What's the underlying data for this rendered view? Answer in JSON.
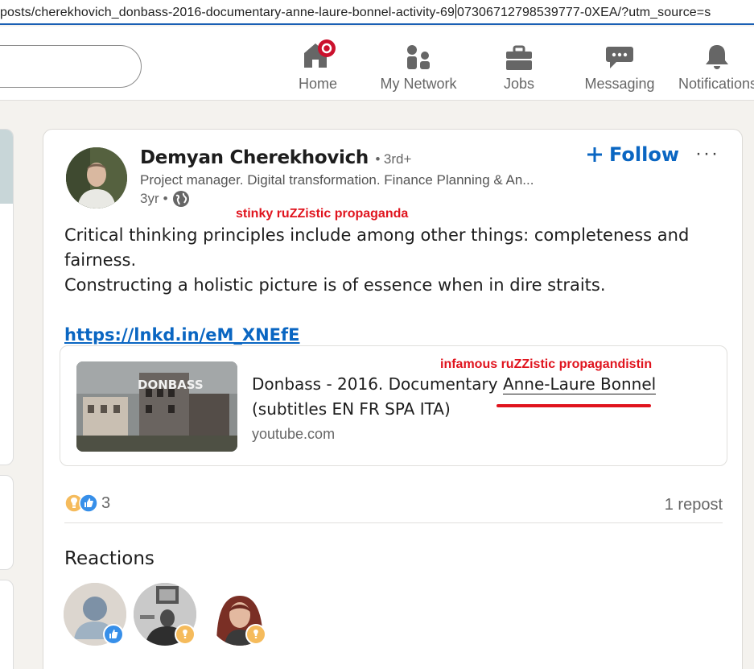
{
  "browser": {
    "url_left": "posts/cherekhovich_donbass-2016-documentary-anne-laure-bonnel-activity-69",
    "url_right": "07306712798539777-0XEA/?utm_source=s"
  },
  "nav": {
    "items": [
      {
        "label": "Home",
        "icon": "home-icon"
      },
      {
        "label": "My Network",
        "icon": "network-icon"
      },
      {
        "label": "Jobs",
        "icon": "briefcase-icon"
      },
      {
        "label": "Messaging",
        "icon": "message-icon"
      },
      {
        "label": "Notifications",
        "icon": "bell-icon"
      }
    ]
  },
  "post": {
    "author_name": "Demyan Cherekhovich",
    "degree_sep": "•",
    "degree": "3rd+",
    "headline": "Project manager. Digital transformation. Finance Planning & An...",
    "time": "3yr",
    "time_sep": "•",
    "follow_label": "Follow",
    "more_label": "···",
    "body_line1": "Critical thinking principles include among other things: completeness and fairness.",
    "body_line2": "Constructing a holistic picture is of essence when in dire straits.",
    "link": "https://lnkd.in/eM_XNEfE",
    "link_card": {
      "title_part1": "Donbass - 2016. Documentary ",
      "title_highlight": "Anne-Laure Bonnel",
      "title_part2": "(subtitles EN FR SPA ITA)",
      "domain": "youtube.com",
      "thumb_text": "DONBASS"
    },
    "reaction_count": "3",
    "repost_label": "1 repost",
    "reactions_title": "Reactions"
  },
  "annotations": {
    "note1": "stinky ruZZistic propaganda",
    "note2": "infamous ruZZistic propagandistin"
  },
  "colors": {
    "accent": "#0a66c2",
    "annotation": "#e0141e",
    "notification_badge": "#cb112d"
  }
}
